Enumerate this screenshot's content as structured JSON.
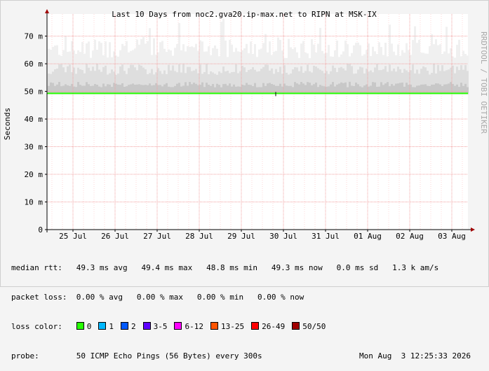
{
  "chart_data": {
    "type": "area",
    "title": "Last 10 Days from noc2.gva20.ip-max.net to RIPN at MSK-IX",
    "ylabel": "Seconds",
    "watermark": "RRDTOOL / TOBI OETIKER",
    "x_tick_labels": [
      "25 Jul",
      "26 Jul",
      "27 Jul",
      "28 Jul",
      "29 Jul",
      "30 Jul",
      "31 Jul",
      "01 Aug",
      "02 Aug",
      "03 Aug"
    ],
    "y_ticks": [
      {
        "value": 0,
        "label": "0"
      },
      {
        "value": 10,
        "label": "10 m"
      },
      {
        "value": 20,
        "label": "20 m"
      },
      {
        "value": 30,
        "label": "30 m"
      },
      {
        "value": 40,
        "label": "40 m"
      },
      {
        "value": 50,
        "label": "50 m"
      },
      {
        "value": 60,
        "label": "60 m"
      },
      {
        "value": 70,
        "label": "70 m"
      }
    ],
    "ylim": [
      0,
      78
    ],
    "series": [
      {
        "name": "median rtt",
        "description": "median round trip time (ms), loss 0% → green",
        "approx_value": 49.3
      },
      {
        "name": "smoke",
        "description": "spread of ping round trip times (ms)",
        "approx_range": [
          49,
          78
        ]
      }
    ]
  },
  "stats": {
    "median_label": "median rtt:",
    "median_values": "49.3 ms avg   49.4 ms max   48.8 ms min   49.3 ms now   0.0 ms sd   1.3 k am/s",
    "loss_label": "packet loss:",
    "loss_values": "0.00 % avg   0.00 % max   0.00 % min   0.00 % now",
    "color_label": "loss color:",
    "probe_label": "probe:",
    "probe_text": "50 ICMP Echo Pings (56 Bytes) every 300s",
    "timestamp": "Mon Aug  3 12:25:33 2026"
  },
  "loss_colors": [
    {
      "label": "0",
      "color": "#26ff00"
    },
    {
      "label": "1",
      "color": "#00b8ff"
    },
    {
      "label": "2",
      "color": "#0059ff"
    },
    {
      "label": "3-5",
      "color": "#5e00ff"
    },
    {
      "label": "6-12",
      "color": "#ff00ff"
    },
    {
      "label": "13-25",
      "color": "#ff5500"
    },
    {
      "label": "26-49",
      "color": "#ff0000"
    },
    {
      "label": "50/50",
      "color": "#a10000"
    }
  ]
}
